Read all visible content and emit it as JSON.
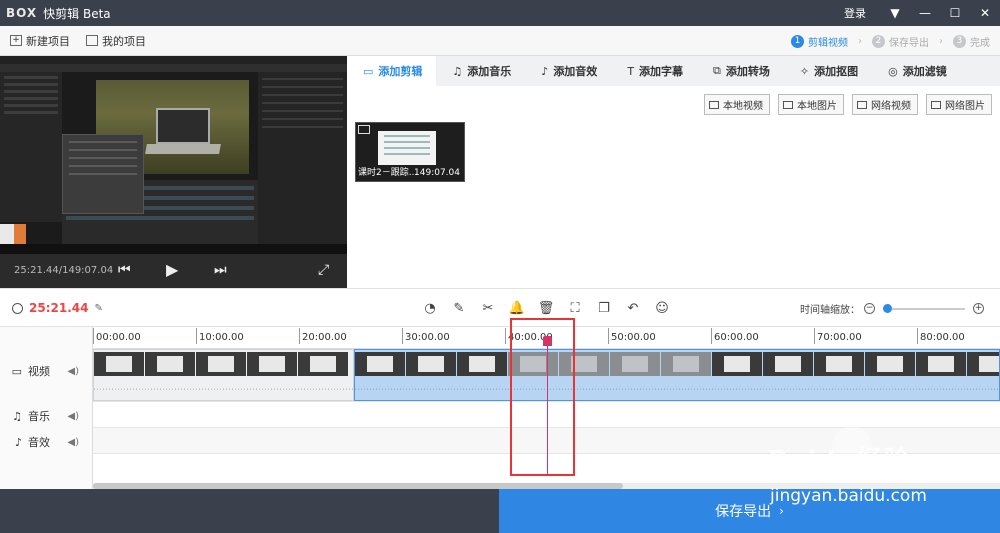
{
  "titlebar": {
    "logo": "BOX",
    "title": "快剪辑 Beta",
    "login": "登录",
    "controls": [
      "▼",
      "—",
      "☐",
      "✕"
    ]
  },
  "toolbar": {
    "new_project": "新建项目",
    "my_projects": "我的项目",
    "steps": [
      {
        "num": "1",
        "label": "剪辑视频"
      },
      {
        "num": "2",
        "label": "保存导出"
      },
      {
        "num": "3",
        "label": "完成"
      }
    ]
  },
  "preview": {
    "timecode": "25:21.44/149:07.04",
    "prev_icon": "prev-frame-icon",
    "play_icon": "play-icon",
    "next_icon": "next-frame-icon",
    "fullscreen_icon": "fullscreen-icon"
  },
  "tabs": [
    {
      "icon": "camera-icon",
      "glyph": "▭",
      "label": "添加剪辑"
    },
    {
      "icon": "music-icon",
      "glyph": "♫",
      "label": "添加音乐"
    },
    {
      "icon": "sound-effect-icon",
      "glyph": "♪",
      "label": "添加音效"
    },
    {
      "icon": "text-icon",
      "glyph": "T",
      "label": "添加字幕"
    },
    {
      "icon": "transition-icon",
      "glyph": "⧉",
      "label": "添加转场"
    },
    {
      "icon": "cutout-icon",
      "glyph": "✧",
      "label": "添加抠图"
    },
    {
      "icon": "filter-icon",
      "glyph": "◎",
      "label": "添加滤镜"
    }
  ],
  "sources": [
    "本地视频",
    "本地图片",
    "网络视频",
    "网络图片"
  ],
  "media": {
    "clip_label": "课时2－跟踪...",
    "clip_duration": "149:07.04"
  },
  "edit_bar": {
    "current_time": "25:21.44",
    "tools": [
      {
        "name": "speed-icon",
        "glyph": "◔"
      },
      {
        "name": "edit-pen-icon",
        "glyph": "✎"
      },
      {
        "name": "scissors-icon",
        "glyph": "✂"
      },
      {
        "name": "bell-icon",
        "glyph": "🔔"
      },
      {
        "name": "trash-icon",
        "glyph": "🗑"
      },
      {
        "name": "crop-icon",
        "glyph": "⛶"
      },
      {
        "name": "copy-icon",
        "glyph": "❐"
      },
      {
        "name": "undo-icon",
        "glyph": "↶"
      },
      {
        "name": "sticker-icon",
        "glyph": "☺"
      }
    ],
    "zoom_label": "时间轴缩放：",
    "zoom_level": 0
  },
  "timeline": {
    "ticks": [
      "00:00.00",
      "10:00.00",
      "20:00.00",
      "30:00.00",
      "40:00.00",
      "50:00.00",
      "60:00.00",
      "70:00.00",
      "80:00.00"
    ],
    "tracks": [
      {
        "icon": "video-icon",
        "glyph": "▭",
        "label": "视频"
      },
      {
        "icon": "music-icon",
        "glyph": "♫",
        "label": "音乐"
      },
      {
        "icon": "sound-effect-icon",
        "glyph": "♪",
        "label": "音效"
      }
    ]
  },
  "footer": {
    "export_label": "保存导出",
    "export_arrow": "›"
  },
  "watermark": {
    "text": "Baidu经验",
    "url": "jingyan.baidu.com"
  },
  "colors": {
    "accent": "#2a8ae6",
    "titlebar": "#3b414c",
    "playhead": "#d2336a",
    "highlight": "#e53535",
    "current_time": "#e44444"
  }
}
